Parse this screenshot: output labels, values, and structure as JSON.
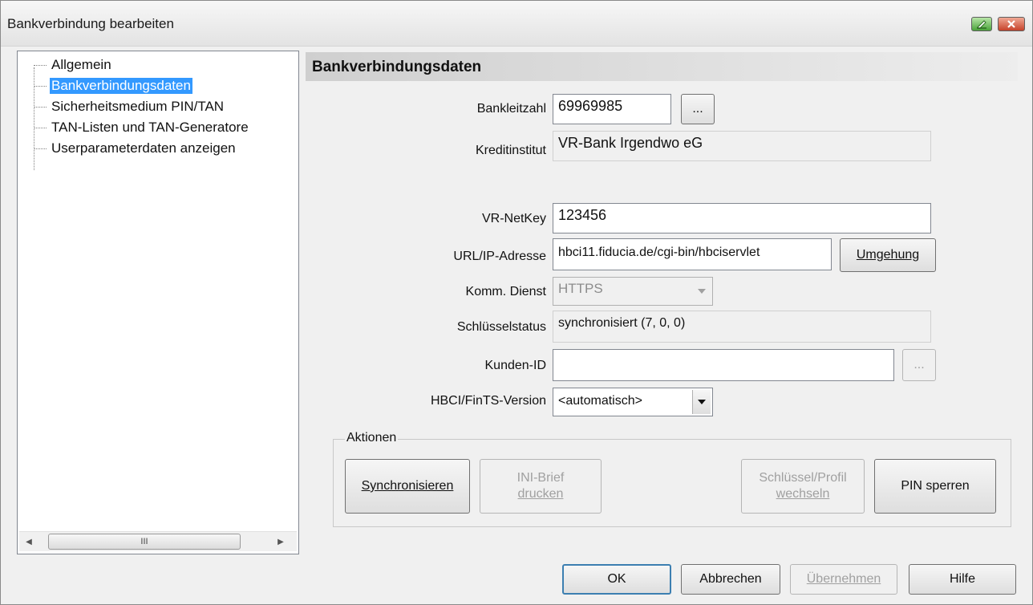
{
  "window": {
    "title": "Bankverbindung bearbeiten"
  },
  "tree": {
    "items": [
      {
        "label": "Allgemein"
      },
      {
        "label": "Bankverbindungsdaten"
      },
      {
        "label": "Sicherheitsmedium PIN/TAN"
      },
      {
        "label": "TAN-Listen und TAN-Generatore"
      },
      {
        "label": "Userparameterdaten anzeigen"
      }
    ],
    "selected": "Bankverbindungsdaten",
    "scroll_thumb": "III"
  },
  "section": {
    "title": "Bankverbindungsdaten"
  },
  "form": {
    "bankleitzahl": {
      "label": "Bankleitzahl",
      "value": "69969985",
      "browse": "..."
    },
    "kreditinstitut": {
      "label": "Kreditinstitut",
      "value": "VR-Bank Irgendwo eG"
    },
    "netkey": {
      "label": "VR-NetKey",
      "value": "123456"
    },
    "url": {
      "label": "URL/IP-Adresse",
      "value": "hbci11.fiducia.de/cgi-bin/hbciservlet",
      "button": "Umgehung"
    },
    "dienst": {
      "label": "Komm. Dienst",
      "value": "HTTPS"
    },
    "schluesselstatus": {
      "label": "Schlüsselstatus",
      "value": "synchronisiert (7, 0, 0)"
    },
    "kunden_id": {
      "label": "Kunden-ID",
      "value": "",
      "browse": "..."
    },
    "version": {
      "label": "HBCI/FinTS-Version",
      "value": "<automatisch>"
    }
  },
  "actions": {
    "title": "Aktionen",
    "synchronisieren": "Synchronisieren",
    "ini_brief_line1": "INI-Brief",
    "ini_brief_line2": "drucken",
    "schluessel_line1": "Schlüssel/Profil",
    "schluessel_line2": "wechseln",
    "pin_sperren": "PIN sperren"
  },
  "footer": {
    "ok": "OK",
    "abbrechen": "Abbrechen",
    "uebernehmen": "Übernehmen",
    "hilfe": "Hilfe"
  }
}
